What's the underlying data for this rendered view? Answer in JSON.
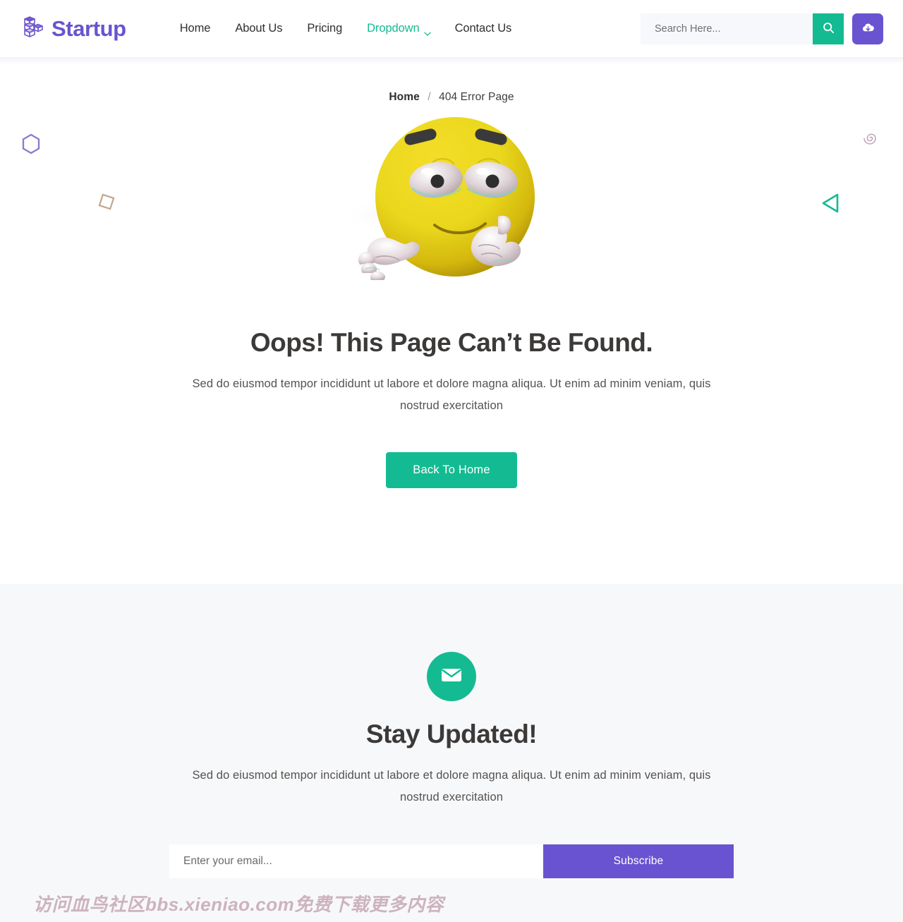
{
  "header": {
    "brand": {
      "name": "Startup",
      "logo_icon": "stacked-cubes-icon",
      "color": "#6a53d0"
    },
    "nav": [
      {
        "label": "Home",
        "active": false
      },
      {
        "label": "About Us",
        "active": false
      },
      {
        "label": "Pricing",
        "active": false
      },
      {
        "label": "Dropdown",
        "active": true,
        "icon": "chevron-down-icon"
      },
      {
        "label": "Contact Us",
        "active": false
      }
    ],
    "search": {
      "placeholder": "Search Here...",
      "value": "",
      "icon": "search-icon"
    },
    "download": {
      "icon": "cloud-download-icon",
      "color": "#6a53d0"
    }
  },
  "breadcrumb": {
    "home": "Home",
    "separator": "/",
    "current": "404 Error Page"
  },
  "error": {
    "illustration": "confused-emoji-illustration",
    "title": "Oops! This Page Can’t Be Found.",
    "description": "Sed do eiusmod tempor incididunt ut labore et dolore magna aliqua. Ut enim ad minim veniam, quis nostrud exercitation",
    "button_label": "Back To Home",
    "button_color": "#14bb92",
    "decorations": [
      {
        "name": "hexagon-outline",
        "color": "#8d7ad6"
      },
      {
        "name": "diamond-outline",
        "color": "#c2a68f"
      },
      {
        "name": "spiral-outline",
        "color": "#c0a3b5"
      },
      {
        "name": "triangle-outline",
        "color": "#14bb92"
      }
    ]
  },
  "newsletter": {
    "icon": "envelope-icon",
    "icon_bg": "#14bb92",
    "title": "Stay Updated!",
    "description": "Sed do eiusmod tempor incididunt ut labore et dolore magna aliqua. Ut enim ad minim veniam, quis nostrud exercitation",
    "email_placeholder": "Enter your email...",
    "email_value": "",
    "subscribe_label": "Subscribe",
    "subscribe_color": "#6a53d0"
  },
  "watermark": {
    "text": "访问血鸟社区bbs.xieniao.com免费下载更多内容"
  }
}
